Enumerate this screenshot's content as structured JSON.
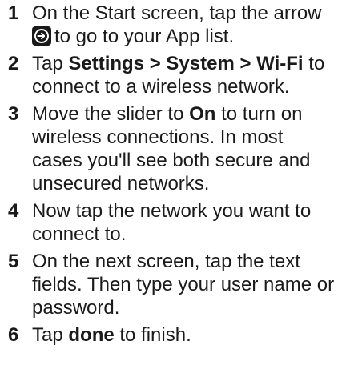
{
  "steps": [
    {
      "number": "1",
      "line1": "On the Start screen, tap the arrow",
      "icon": "right-arrow-circle-icon",
      "line2": "to go to your App list."
    },
    {
      "number": "2",
      "pre": "Tap ",
      "b1": "Settings",
      "sep1": " > ",
      "b2": "System",
      "sep2": " > ",
      "b3": "Wi-Fi",
      "post": " to",
      "line2": "connect to a wireless network."
    },
    {
      "number": "3",
      "pre": "Move the slider to ",
      "bold": "On",
      "post": " to turn on",
      "line2": "wireless connections. In most",
      "line3": "cases you'll see both secure and",
      "line4": "unsecured networks."
    },
    {
      "number": "4",
      "line1": "Now tap the network you want to",
      "line2": "connect to."
    },
    {
      "number": "5",
      "line1": "On the next screen, tap the text",
      "line2": "fields. Then type your user name or",
      "line3": "password."
    },
    {
      "number": "6",
      "pre": "Tap ",
      "bold": "done",
      "post": " to finish."
    }
  ]
}
